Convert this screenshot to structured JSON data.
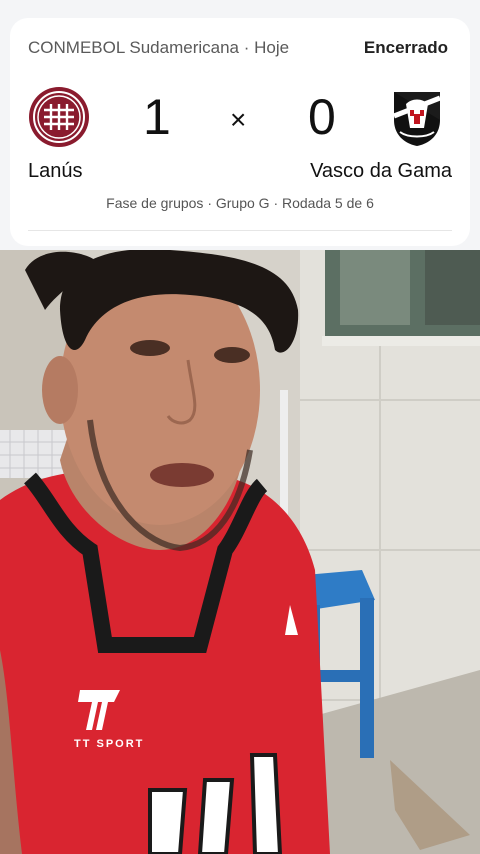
{
  "match": {
    "league": "CONMEBOL Sudamericana · Hoje",
    "status": "Encerrado",
    "home_team": "Lanús",
    "away_team": "Vasco da Gama",
    "home_score": "1",
    "away_score": "0",
    "separator": "×",
    "stage": "Fase de grupos · Grupo G · Rodada 5 de 6"
  },
  "shirt_text": "TT SPORT",
  "colors": {
    "lanus_red": "#8a1b2e",
    "vasco_black": "#111111",
    "jersey_red": "#d92530"
  },
  "icons": [
    "lanus-logo-icon",
    "vasco-logo-icon"
  ]
}
